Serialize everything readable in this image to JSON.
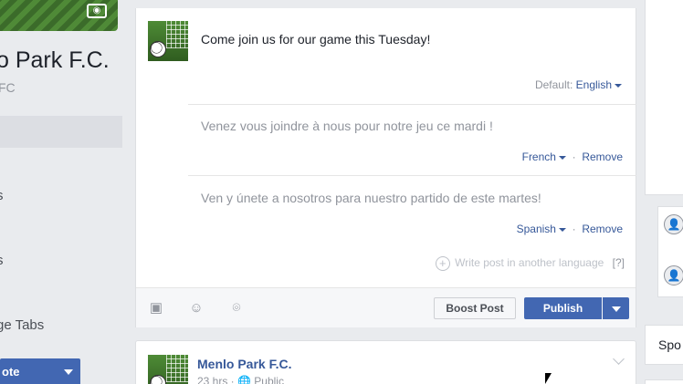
{
  "sidebar": {
    "page_name": "o Park F.C.",
    "page_handle": "FC",
    "nav_items": [
      {
        "label": "s"
      },
      {
        "label": "s"
      },
      {
        "label": "ge Tabs"
      }
    ],
    "promote_label": "ote"
  },
  "composer": {
    "post_text": "Come join us for our game this Tuesday!",
    "default_prefix": "Default:",
    "default_language": "English",
    "translations": [
      {
        "text": "Venez vous joindre à nous pour notre jeu ce mardi !",
        "language": "French",
        "remove_label": "Remove"
      },
      {
        "text": "Ven y únete a nosotros para nuestro partido de este martes!",
        "language": "Spanish",
        "remove_label": "Remove"
      }
    ],
    "write_another_label": "Write post in another language",
    "help_label": "[?]",
    "boost_label": "Boost Post",
    "publish_label": "Publish",
    "dot_separator": "·"
  },
  "feed_post": {
    "author": "Menlo Park F.C.",
    "meta": "23 hrs · 🌐 Public"
  },
  "right_column": {
    "sponsored_label": "Spo"
  }
}
